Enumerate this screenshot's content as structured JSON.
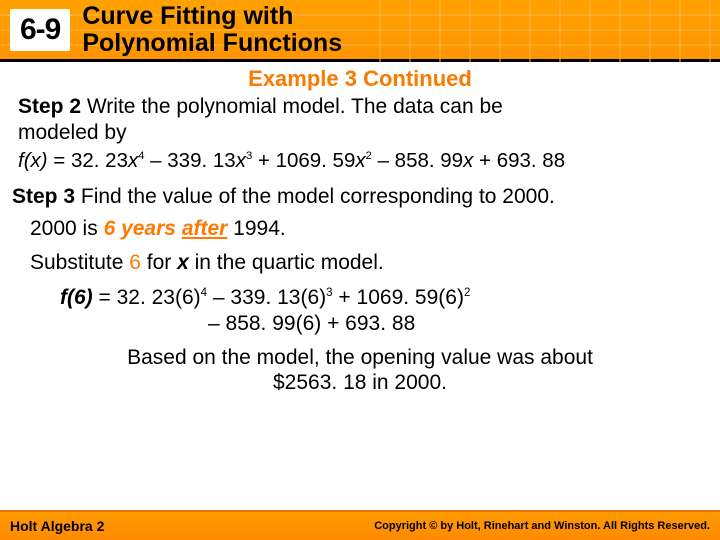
{
  "header": {
    "section_number": "6-9",
    "title_line1": "Curve Fitting with",
    "title_line2": "Polynomial Functions"
  },
  "example_title": "Example 3 Continued",
  "step2": {
    "label": "Step 2",
    "text_part1": " Write the polynomial model. The data can be",
    "text_part2": "modeled by"
  },
  "formula": {
    "fx": "f",
    "paren_x": "(x)",
    "eq": " = 32. 23",
    "x4": "x",
    "term2": " – 339. 13",
    "x3": "x",
    "term3": " + 1069. 59",
    "x2": "x",
    "term4": " – 858. 99",
    "x1": "x",
    "term5": " + 693. 88"
  },
  "step3": {
    "label": "Step 3",
    "text": " Find the value of the model corresponding to 2000."
  },
  "line2000": {
    "pre": "2000 is ",
    "six_years": "6 years",
    "space": " ",
    "after": "after",
    "post": " 1994."
  },
  "substitute": {
    "pre": "Substitute ",
    "six": "6",
    "mid": " for ",
    "x": "x",
    "post": " in the quartic model."
  },
  "f6": {
    "label": "f(6)",
    "eq": " = 32. 23(6)",
    "t2": " – 339. 13(6)",
    "t3": " + 1069. 59(6)",
    "line2": "– 858. 99(6) + 693. 88"
  },
  "conclusion": {
    "l1": "Based on the model, the opening value was about",
    "l2": "$2563. 18 in 2000."
  },
  "footer": {
    "left": "Holt Algebra 2",
    "right": "Copyright © by Holt, Rinehart and Winston. All Rights Reserved."
  }
}
